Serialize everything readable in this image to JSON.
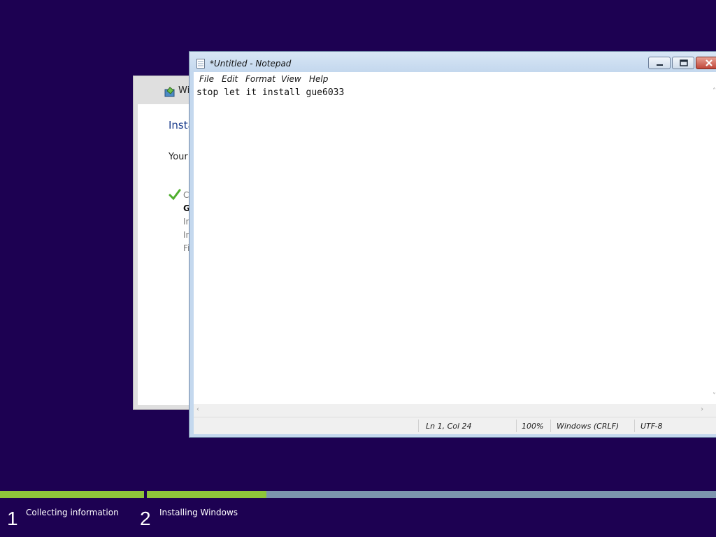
{
  "setup": {
    "title_fragment": "Wi",
    "heading_fragment": "Insta",
    "description_fragment": "Your",
    "steps": [
      {
        "fragment": "C",
        "state": "done"
      },
      {
        "fragment": "G",
        "state": "current"
      },
      {
        "fragment": "In",
        "state": "pending"
      },
      {
        "fragment": "In",
        "state": "pending"
      },
      {
        "fragment": "Fi",
        "state": "pending"
      }
    ]
  },
  "notepad": {
    "title": "*Untitled - Notepad",
    "menu": [
      "File",
      "Edit",
      "Format",
      "View",
      "Help"
    ],
    "content": "stop let it install gue6033",
    "status": {
      "position": "Ln 1, Col 24",
      "zoom": "100%",
      "line_endings": "Windows (CRLF)",
      "encoding": "UTF-8"
    }
  },
  "progress": {
    "phases": [
      {
        "number": "1",
        "label": "Collecting information",
        "fill": 1.0
      },
      {
        "number": "2",
        "label": "Installing Windows",
        "fill": 0.21
      }
    ]
  },
  "colors": {
    "background": "#1d0152",
    "progress_fill": "#8ec43a",
    "progress_track": "#7c95ae",
    "heading_blue": "#1a3c8c"
  },
  "icons": {
    "setup": "setup-icon",
    "check": "check-icon",
    "notepad": "notepad-icon"
  }
}
